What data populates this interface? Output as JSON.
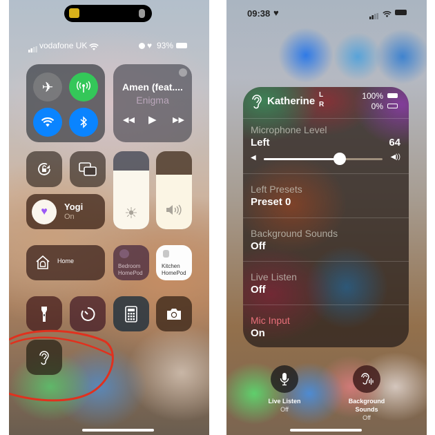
{
  "left_screen": {
    "status_bar": {
      "carrier": "vodafone UK",
      "battery_percent": "93%",
      "icons": [
        "signal-icon",
        "wifi-icon",
        "alarm-icon",
        "heart-icon",
        "battery-icon"
      ]
    },
    "connectivity": {
      "airplane": {
        "icon": "airplane-icon",
        "state": "off"
      },
      "cellular": {
        "icon": "cellular-antenna-icon",
        "state": "on",
        "color": "#34c759"
      },
      "wifi": {
        "icon": "wifi-icon",
        "state": "on",
        "color": "#0a84ff"
      },
      "bluetooth": {
        "icon": "bluetooth-icon",
        "state": "on",
        "color": "#0a84ff"
      }
    },
    "now_playing": {
      "title": "Amen (feat....",
      "artist": "Enigma",
      "controls": [
        "rewind",
        "play",
        "fast-forward"
      ]
    },
    "orientation_lock": {
      "icon": "rotation-lock-icon"
    },
    "screen_mirroring": {
      "icon": "screen-mirroring-icon"
    },
    "focus": {
      "name": "Yogi",
      "status": "On",
      "color": "#9b59f5"
    },
    "brightness": {
      "level_percent": 75
    },
    "volume": {
      "level_percent": 70
    },
    "home": {
      "label": "Home"
    },
    "homepods": [
      {
        "label_line1": "Bedroom",
        "label_line2": "HomePod",
        "active": false
      },
      {
        "label_line1": "Kitchen",
        "label_line2": "HomePod",
        "active": true
      }
    ],
    "shortcuts": [
      "flashlight",
      "timer",
      "calculator",
      "camera"
    ],
    "hearing": {
      "icon": "ear-icon",
      "annotation_color": "#e0311e"
    }
  },
  "right_screen": {
    "status_bar": {
      "time": "09:38",
      "icons": [
        "heart-icon",
        "signal-icon",
        "wifi-icon",
        "battery-icon"
      ]
    },
    "hearing_panel": {
      "device_name": "Katherine",
      "left_label": "L",
      "right_label": "R",
      "left_battery": "100%",
      "right_battery": "0%",
      "microphone": {
        "title": "Microphone Level",
        "side": "Left",
        "value": "64",
        "slider_fraction": 0.64
      },
      "rows": [
        {
          "label": "Left Presets",
          "value": "Preset 0"
        },
        {
          "label": "Background Sounds",
          "value": "Off"
        },
        {
          "label": "Live Listen",
          "value": "Off"
        },
        {
          "label": "Mic Input",
          "value": "On",
          "label_color": "#e8707a"
        }
      ]
    },
    "bottom_buttons": [
      {
        "icon": "microphone-icon",
        "label": "Live Listen",
        "state": "Off"
      },
      {
        "icon": "ear-sound-icon",
        "label_line1": "Background",
        "label_line2": "Sounds",
        "state": "Off"
      }
    ]
  }
}
